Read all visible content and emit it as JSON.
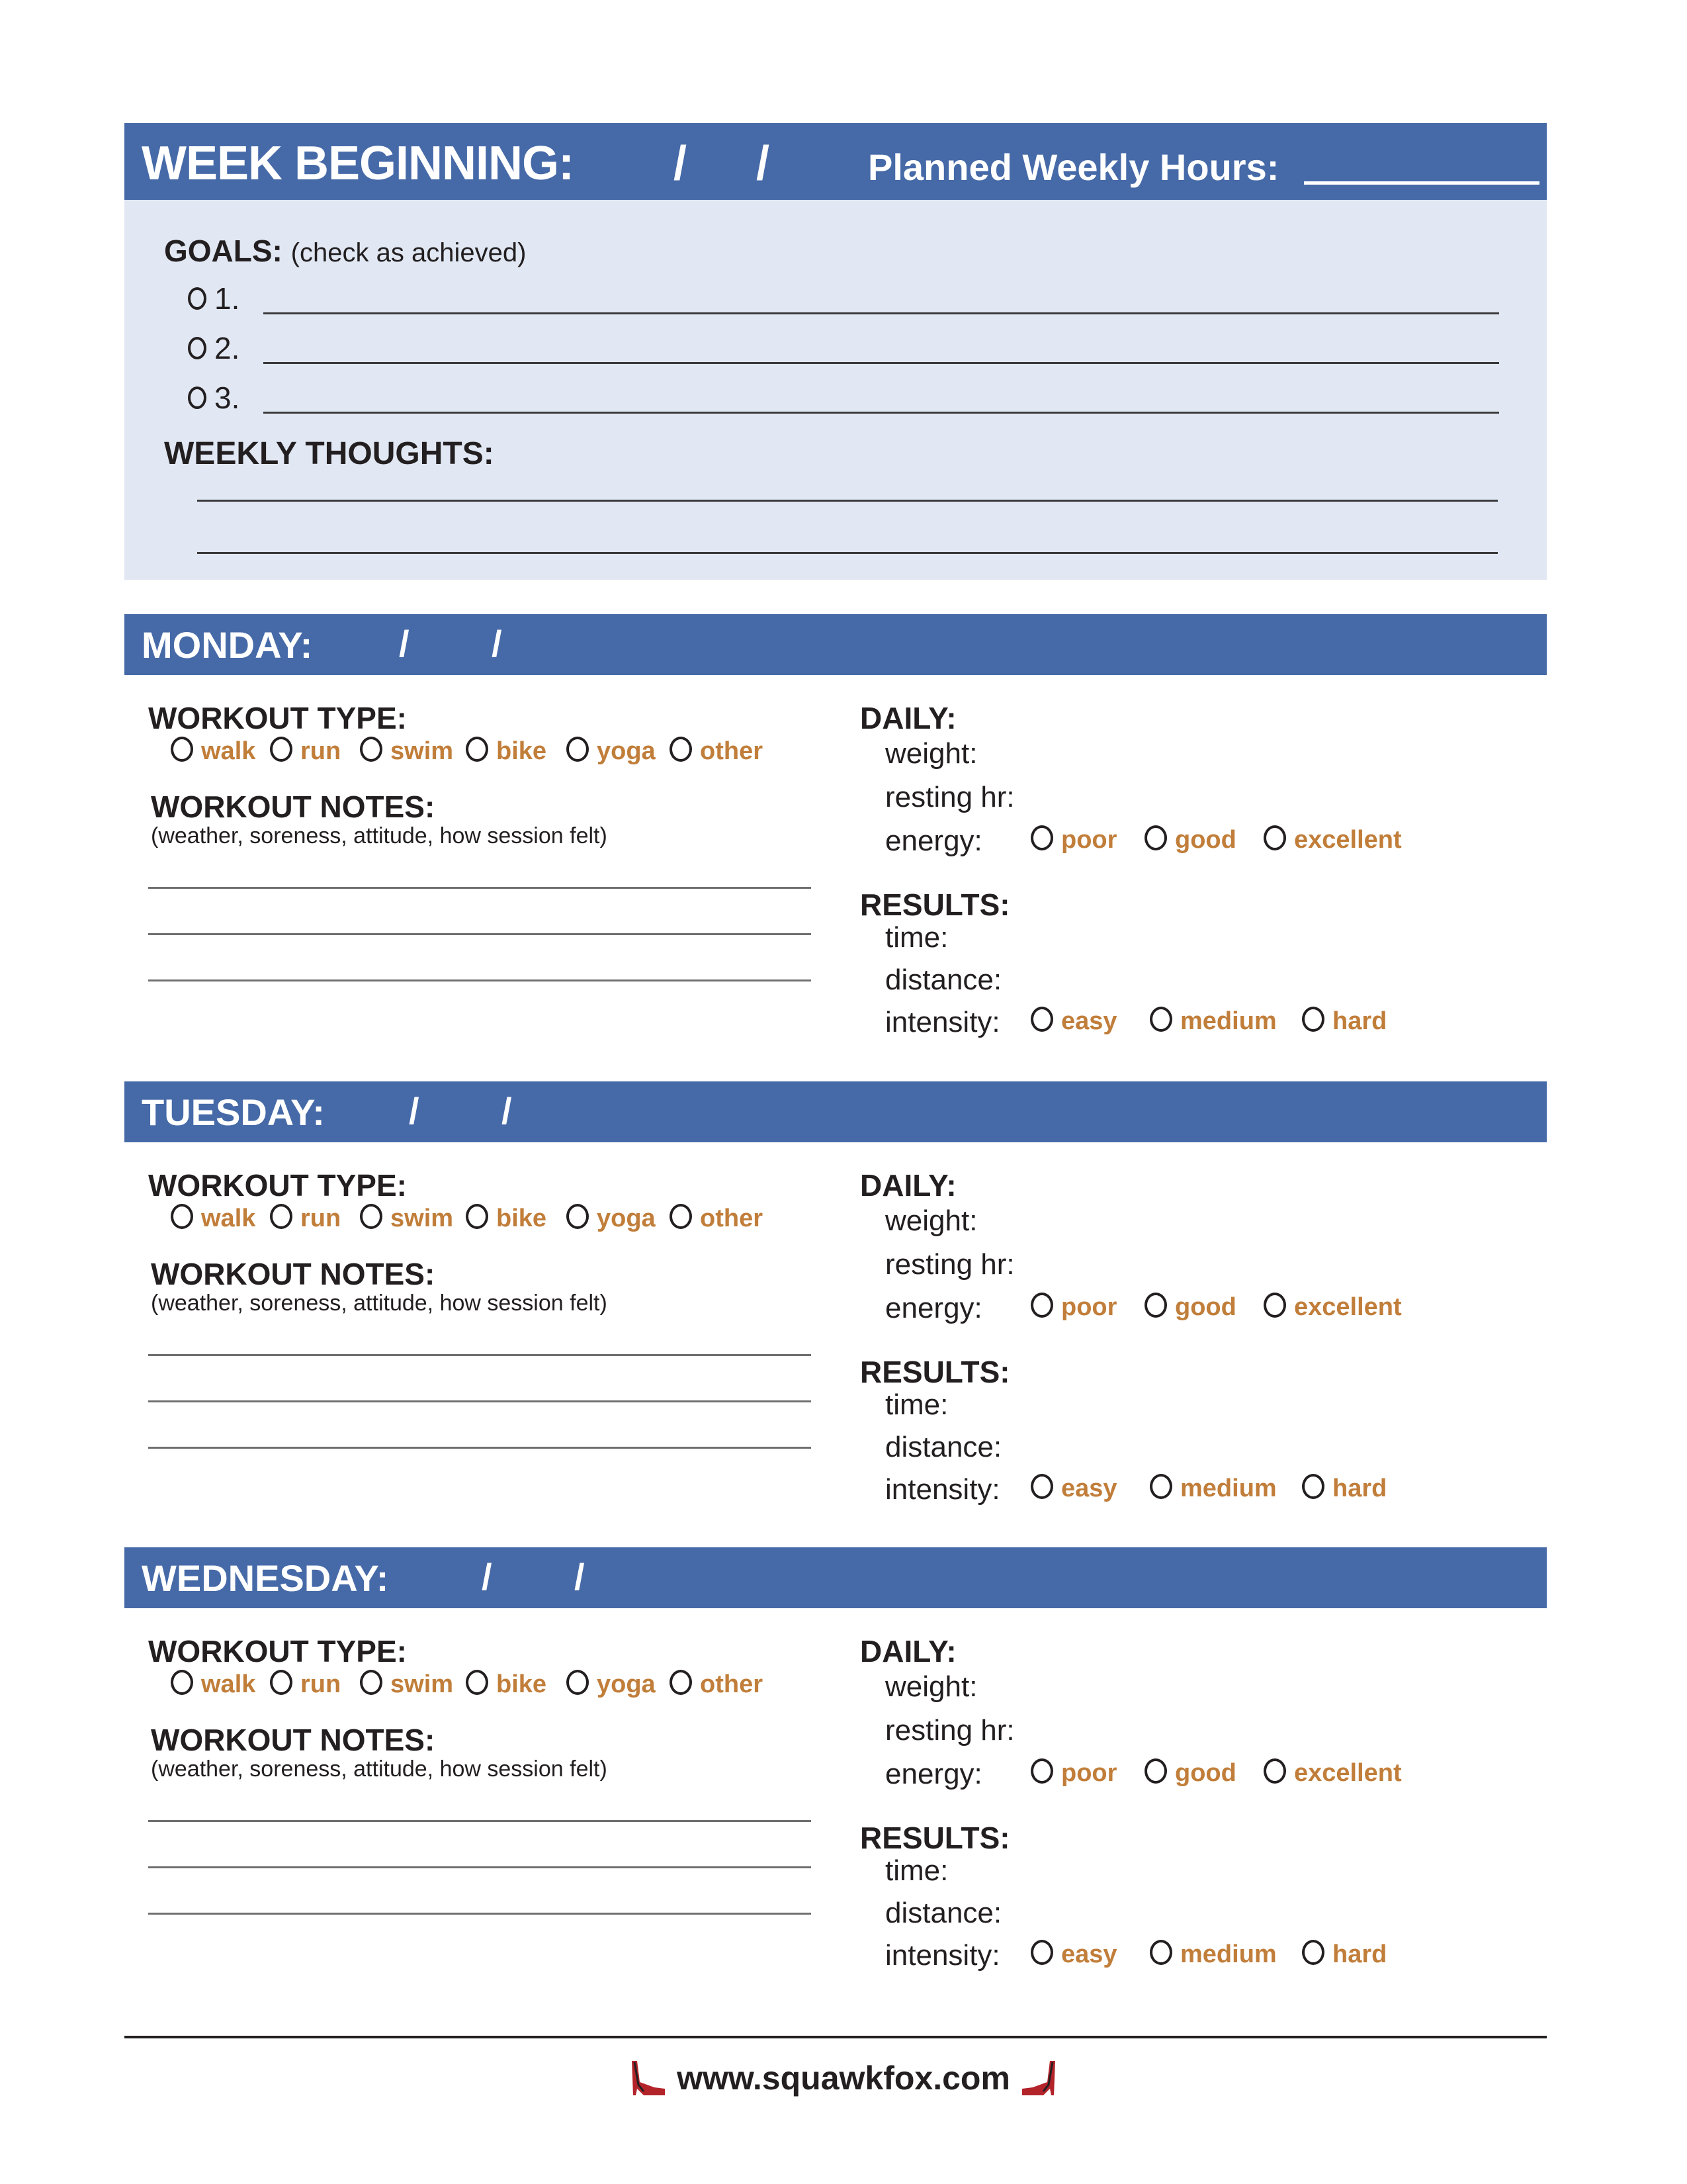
{
  "week": {
    "title": "WEEK BEGINNING:",
    "date_separators": [
      "/",
      "/"
    ],
    "planned_hours_label": "Planned Weekly Hours:"
  },
  "goals": {
    "heading": "GOALS:",
    "subheading": "(check as achieved)",
    "items": [
      {
        "number": "1."
      },
      {
        "number": "2."
      },
      {
        "number": "3."
      }
    ],
    "thoughts_heading": "WEEKLY THOUGHTS:"
  },
  "labels": {
    "workout_type": "WORKOUT TYPE:",
    "workout_notes": "WORKOUT NOTES:",
    "notes_hint": "(weather, soreness, attitude, how session felt)",
    "daily": "DAILY:",
    "weight": "weight:",
    "resting_hr": "resting hr:",
    "energy": "energy:",
    "results": "RESULTS:",
    "time": "time:",
    "distance": "distance:",
    "intensity": "intensity:"
  },
  "workout_types": [
    "walk",
    "run",
    "swim",
    "bike",
    "yoga",
    "other"
  ],
  "energy_options": [
    "poor",
    "good",
    "excellent"
  ],
  "intensity_options": [
    "easy",
    "medium",
    "hard"
  ],
  "days": [
    {
      "name": "MONDAY:",
      "date_separators": [
        "/",
        "/"
      ]
    },
    {
      "name": "TUESDAY:",
      "date_separators": [
        "/",
        "/"
      ]
    },
    {
      "name": "WEDNESDAY:",
      "date_separators": [
        "/",
        "/"
      ]
    }
  ],
  "footer": {
    "url": "www.squawkfox.com",
    "icon": "high-heel-shoe-icon"
  },
  "colors": {
    "header_blue": "#466aa8",
    "panel_light_blue": "#e1e8f3",
    "option_orange": "#c17e3a",
    "text_dark": "#231f20",
    "shoe_red": "#b3232a"
  }
}
